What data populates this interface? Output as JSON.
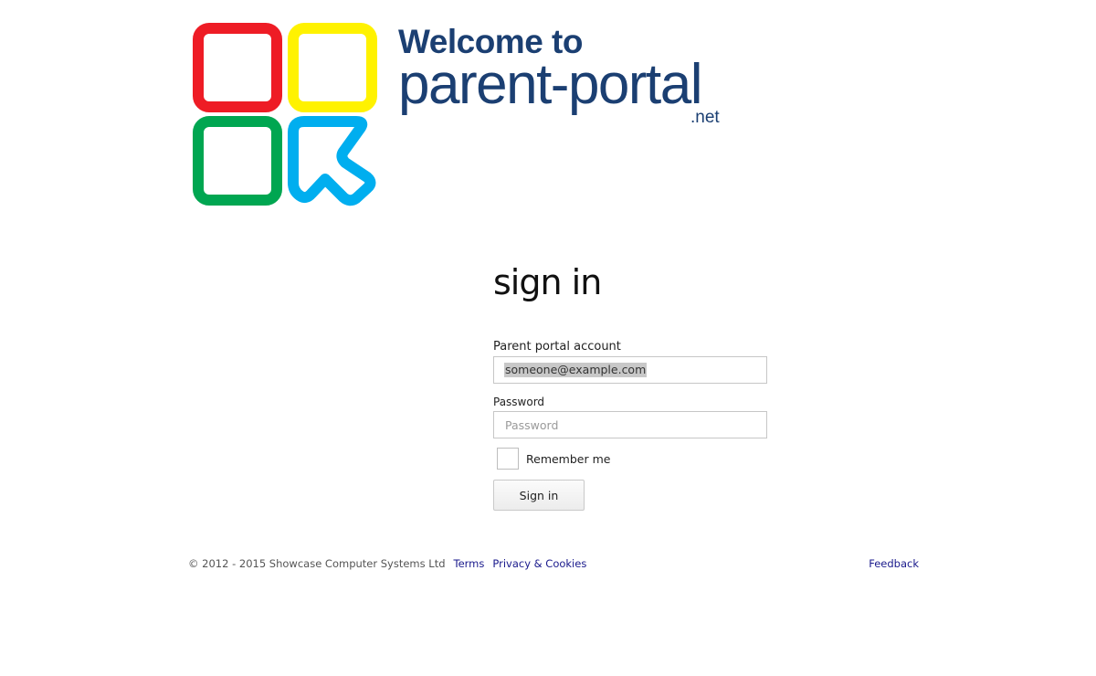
{
  "logo": {
    "welcome_text": "Welcome to",
    "name_text": "parent-portal",
    "tld_text": ".net",
    "colors": {
      "red": "#ee1c25",
      "yellow": "#fff200",
      "green": "#00a651",
      "blue": "#00aeef",
      "text": "#1b3f72"
    }
  },
  "form": {
    "heading": "sign in",
    "account_label": "Parent portal account",
    "account_value": "someone@example.com",
    "password_label": "Password",
    "password_placeholder": "Password",
    "remember_label": "Remember me",
    "remember_checked": false,
    "submit_label": "Sign in"
  },
  "footer": {
    "copyright": "© 2012 - 2015 Showcase Computer Systems Ltd",
    "terms_link": "Terms",
    "privacy_link": "Privacy & Cookies",
    "feedback_link": "Feedback",
    "link_color": "#1a1a8c"
  }
}
